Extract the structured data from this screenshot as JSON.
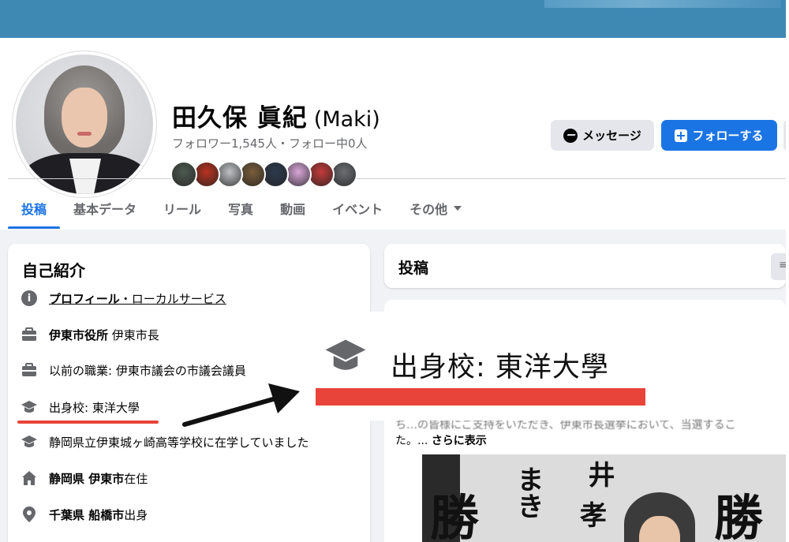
{
  "profile": {
    "name": "田久保 眞紀",
    "name_en": "(Maki)",
    "follow_stats": "フォロワー1,545人・フォロー中0人",
    "friend_avatar_colors": [
      "#4d5a4f",
      "#b8321f",
      "#bfc2c6",
      "#7a5d3a",
      "#2d3a4d",
      "#d9a7d9",
      "#c43a3a",
      "#6b6e72"
    ]
  },
  "actions": {
    "message_label": "メッセージ",
    "follow_label": "フォローする"
  },
  "tabs": [
    {
      "label": "投稿",
      "active": true
    },
    {
      "label": "基本データ"
    },
    {
      "label": "リール"
    },
    {
      "label": "写真"
    },
    {
      "label": "動画"
    },
    {
      "label": "イベント"
    },
    {
      "label": "その他"
    }
  ],
  "intro": {
    "title": "自己紹介",
    "profile_link_bold": "プロフィール",
    "profile_link_rest": "・ローカルサービス",
    "work_current_bold": "伊東市役所",
    "work_current_rest": " 伊東市長",
    "work_previous": "以前の職業: 伊東市議会の市議会議員",
    "education_college": "出身校: 東洋大學",
    "education_highschool": "静岡県立伊東城ヶ崎高等学校に在学していました",
    "lives_bold": "静岡県 伊東市",
    "lives_rest": "在住",
    "from_bold": "千葉県 船橋市",
    "from_rest": "出身"
  },
  "posts": {
    "title": "投稿",
    "filter_glyph": "≡",
    "text_partial": "ち…の皆様にご支持をいただき、伊東市長選挙において、当選するこ",
    "text_line2": "た。...",
    "see_more": "さらに表示",
    "photo_text": [
      "勝",
      "まき",
      "井",
      "孝",
      "勝"
    ]
  },
  "zoom_callout": {
    "text": "出身校: 東洋大學",
    "highlight_color": "#e8443a"
  },
  "colors": {
    "brand_blue": "#1b74e4",
    "cover": "#3e89b4",
    "highlight_red": "#e8443a"
  }
}
